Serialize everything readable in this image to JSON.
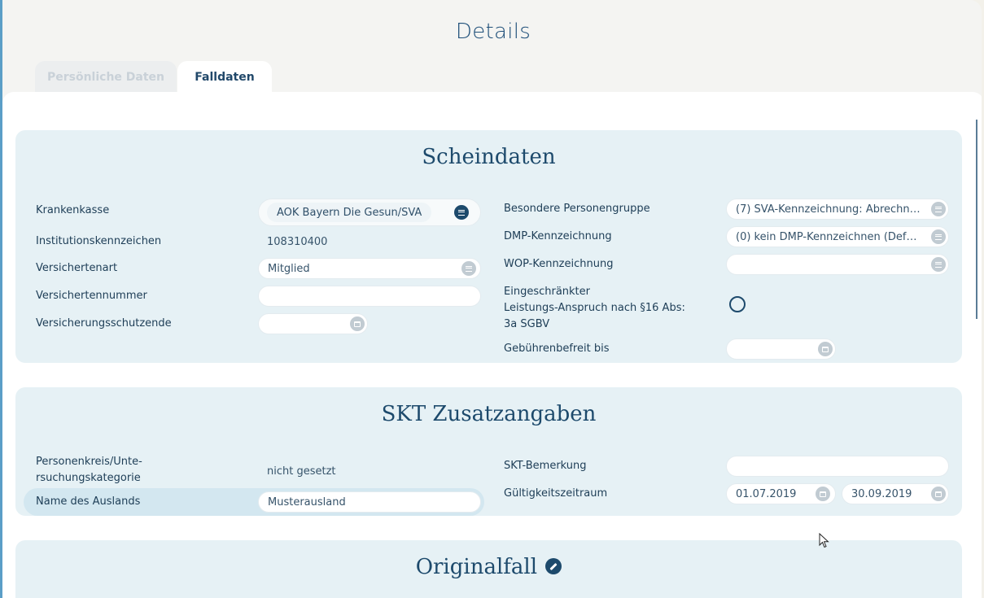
{
  "header": {
    "title": "Details"
  },
  "tabs": [
    {
      "label": "Persönliche Daten",
      "active": false
    },
    {
      "label": "Falldaten",
      "active": true
    }
  ],
  "scheindaten": {
    "title": "Scheindaten",
    "krankenkasse": {
      "label": "Krankenkasse",
      "value": "AOK Bayern Die Gesun/SVA"
    },
    "ik": {
      "label": "Institutionskennzeichen",
      "value": "108310400"
    },
    "versichertenart": {
      "label": "Versichertenart",
      "value": "Mitglied"
    },
    "versichertennummer": {
      "label": "Versichertennummer",
      "value": ""
    },
    "schutzende": {
      "label": "Versicherungsschutzende",
      "value": ""
    },
    "personengruppe": {
      "label": "Besondere Personengruppe",
      "value": "(7) SVA-Kennzeichnung: Abrechnun..."
    },
    "dmp": {
      "label": "DMP-Kennzeichnung",
      "value": "(0) kein DMP-Kennzeichnen (Default..."
    },
    "wop": {
      "label": "WOP-Kennzeichnung",
      "value": ""
    },
    "eingeschraenkt": {
      "label_1": "Eingeschränkter",
      "label_2": "Leistungs-Anspruch nach §16 Abs:",
      "label_3": "3a SGBV"
    },
    "gebuehrenbefreit": {
      "label": "Gebührenbefreit bis",
      "value": ""
    }
  },
  "skt": {
    "title": "SKT Zusatzangaben",
    "personenkreis": {
      "label_1": "Personenkreis/Unte-",
      "label_2": "rsuchungskategorie",
      "value": "nicht gesetzt"
    },
    "ausland": {
      "label": "Name des Auslands",
      "value": "Musterausland"
    },
    "bemerkung": {
      "label": "SKT-Bemerkung",
      "value": ""
    },
    "gueltigkeit": {
      "label": "Gültigkeitszeitraum",
      "from": "01.07.2019",
      "to": "30.09.2019"
    }
  },
  "originalfall": {
    "title": "Originalfall"
  },
  "icons": {
    "menu": "list-icon",
    "calendar": "calendar-icon",
    "edit": "pencil-icon"
  },
  "colors": {
    "accent": "#1d4a6c",
    "panel": "#e6f1f5"
  }
}
